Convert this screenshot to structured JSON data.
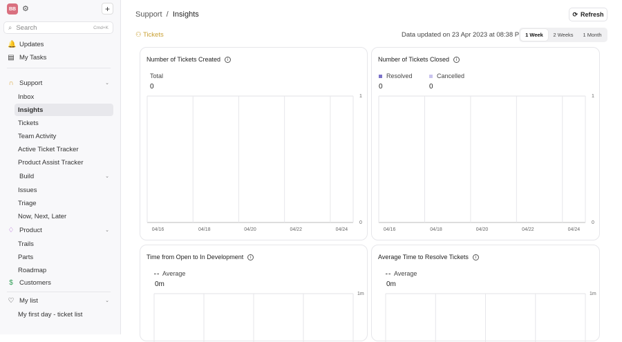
{
  "sidebar": {
    "avatar": "BB",
    "search_placeholder": "Search",
    "search_shortcut": "Cmd+K",
    "top": [
      {
        "label": "Updates",
        "icon": "🔔"
      },
      {
        "label": "My Tasks",
        "icon": "▤"
      }
    ],
    "sections": [
      {
        "label": "Support",
        "icon": "∩",
        "color": "#d9a53a",
        "items": [
          "Inbox",
          "Insights",
          "Tickets",
          "Team Activity",
          "Active Ticket Tracker",
          "Product Assist Tracker"
        ]
      },
      {
        "label": "Build",
        "icon": "</>",
        "color": "#6b5bc4",
        "items": [
          "Issues",
          "Triage",
          "Now, Next, Later"
        ]
      },
      {
        "label": "Product",
        "icon": "♢",
        "color": "#a64fd0",
        "items": [
          "Trails",
          "Parts",
          "Roadmap"
        ]
      }
    ],
    "customers": {
      "label": "Customers",
      "icon": "$",
      "color": "#2f9e55"
    },
    "mylist": {
      "label": "My list",
      "icon": "♡",
      "items": [
        "My first day - ticket list"
      ]
    },
    "active_item": "Insights"
  },
  "header": {
    "breadcrumb_parent": "Support",
    "breadcrumb_sep": "/",
    "breadcrumb_current": "Insights",
    "refresh_label": "Refresh"
  },
  "toolbar": {
    "section_label": "Tickets",
    "updated_text": "Data updated on 23 Apr 2023 at 08:38 PM",
    "ranges": [
      "1 Week",
      "2 Weeks",
      "1 Month"
    ],
    "selected_range": "1 Week"
  },
  "chart_data": [
    {
      "type": "line",
      "title": "Number of Tickets Created",
      "series": [
        {
          "name": "Total",
          "total": "0",
          "color": "#7b6fd0"
        }
      ],
      "categories": [
        "04/16",
        "04/18",
        "04/20",
        "04/22",
        "04/24"
      ],
      "ylim": [
        0,
        1
      ],
      "yticks": [
        "0",
        "1"
      ]
    },
    {
      "type": "bar",
      "title": "Number of Tickets Closed",
      "series": [
        {
          "name": "Resolved",
          "total": "0",
          "color": "#7b72c9"
        },
        {
          "name": "Cancelled",
          "total": "0",
          "color": "#c9c4ee"
        }
      ],
      "categories": [
        "04/16",
        "04/18",
        "04/20",
        "04/22",
        "04/24"
      ],
      "ylim": [
        0,
        1
      ],
      "yticks": [
        "0",
        "1"
      ]
    },
    {
      "type": "line",
      "title": "Time from Open to In Development",
      "series": [
        {
          "name": "Average",
          "total": "0m",
          "color": "#444"
        }
      ],
      "categories": [],
      "yticks": [
        "1m"
      ]
    },
    {
      "type": "line",
      "title": "Average Time to Resolve Tickets",
      "series": [
        {
          "name": "Average",
          "total": "0m",
          "color": "#444"
        }
      ],
      "categories": [],
      "yticks": [
        "1m"
      ]
    }
  ]
}
